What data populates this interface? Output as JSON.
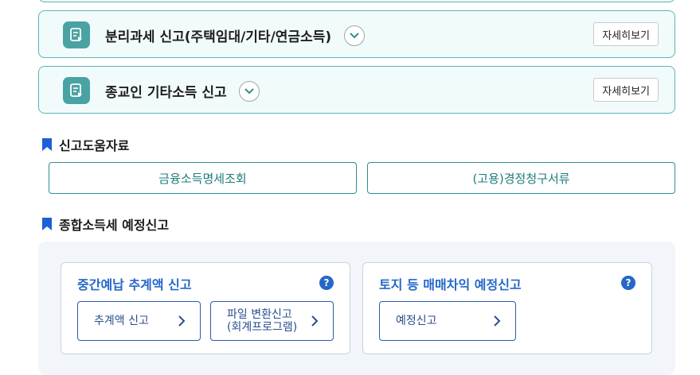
{
  "cards": [
    {
      "title": "분리과세 신고(주택임대/기타/연금소득)",
      "detail_label": "자세히보기",
      "icon": "document-icon"
    },
    {
      "title": "종교인 기타소득 신고",
      "detail_label": "자세히보기",
      "icon": "document-icon"
    }
  ],
  "help_section": {
    "heading": "신고도움자료",
    "buttons": [
      "금융소득명세조회",
      "(고용)경정청구서류"
    ]
  },
  "prepay_section": {
    "heading": "종합소득세 예정신고",
    "boxes": [
      {
        "title": "중간예납 추계액 신고",
        "buttons": [
          {
            "line1": "추계액 신고"
          },
          {
            "line1": "파일 변환신고",
            "line2": "(회계프로그램)"
          }
        ]
      },
      {
        "title": "토지 등 매매차익 예정신고",
        "buttons": [
          {
            "line1": "예정신고"
          }
        ]
      }
    ],
    "help_glyph": "?"
  },
  "colors": {
    "teal": "#2f8f8f",
    "card_bg": "#f2fbfb",
    "blue": "#2667c9",
    "panel_bg": "#f2f6fa"
  }
}
